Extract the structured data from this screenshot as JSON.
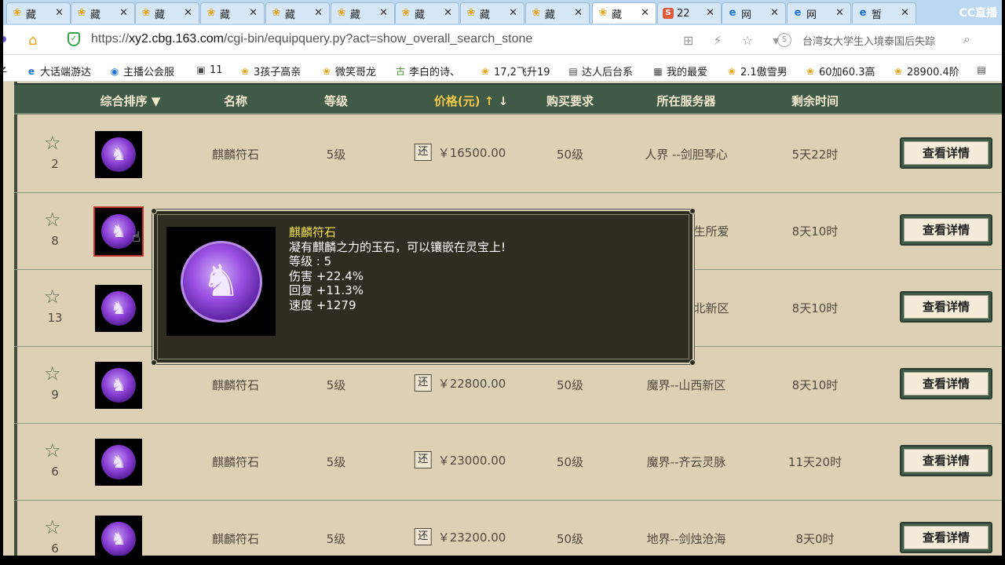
{
  "browser": {
    "tabs": [
      {
        "title": "藏",
        "icon": "cbg-icon",
        "active": false
      },
      {
        "title": "藏",
        "icon": "cbg-icon",
        "active": false
      },
      {
        "title": "藏",
        "icon": "cbg-icon",
        "active": false
      },
      {
        "title": "藏",
        "icon": "cbg-icon",
        "active": false
      },
      {
        "title": "藏",
        "icon": "cbg-icon",
        "active": false
      },
      {
        "title": "藏",
        "icon": "cbg-icon",
        "active": false
      },
      {
        "title": "藏",
        "icon": "cbg-icon",
        "active": false
      },
      {
        "title": "藏",
        "icon": "cbg-icon",
        "active": false
      },
      {
        "title": "藏",
        "icon": "cbg-icon",
        "active": false
      },
      {
        "title": "藏",
        "icon": "cbg-icon",
        "active": true
      },
      {
        "title": "22",
        "icon": "sogou-icon",
        "active": false
      },
      {
        "title": "网",
        "icon": "browser-e-icon",
        "active": false
      },
      {
        "title": "网",
        "icon": "browser-e-icon",
        "active": false
      },
      {
        "title": "暂",
        "icon": "browser-e-icon",
        "active": false
      }
    ],
    "close_glyph": "✕",
    "watermark": "CC直播",
    "url_prefix": "https://",
    "url_host": "xy2.cbg.163.com",
    "url_path": "/cgi-bin/equipquery.py?act=show_overall_search_stone",
    "search_text": "台湾女大学生入境泰国后失踪",
    "search_engine_glyph": "S",
    "toolbar_glyphs": "⊞ ⚡ ☆ ▾",
    "bookmarks": [
      {
        "label": "子",
        "icon": "none"
      },
      {
        "label": "大话端游达",
        "icon": "browser-e-icon"
      },
      {
        "label": "主播公会服",
        "icon": "globe-icon"
      },
      {
        "label": "11",
        "icon": "game-icon"
      },
      {
        "label": "3孩子高亲",
        "icon": "cbg-icon"
      },
      {
        "label": "微笑哥龙",
        "icon": "cbg-icon"
      },
      {
        "label": "李白的诗、",
        "icon": "leaf-icon"
      },
      {
        "label": "17,2飞升19",
        "icon": "cbg-icon"
      },
      {
        "label": "达人后台系",
        "icon": "doc-icon"
      },
      {
        "label": "我的最爱",
        "icon": "grid-icon"
      },
      {
        "label": "2.1傲雪男",
        "icon": "cbg-icon"
      },
      {
        "label": "60加60.3高",
        "icon": "cbg-icon"
      },
      {
        "label": "28900.4阶",
        "icon": "cbg-icon"
      },
      {
        "label": "",
        "icon": "doc-icon"
      }
    ]
  },
  "table": {
    "headers": {
      "sort": "综合排序 ▼",
      "name": "名称",
      "level": "等级",
      "price": "价格(元)",
      "price_up": "↑",
      "price_down": "↓",
      "requirement": "购买要求",
      "server": "所在服务器",
      "remaining": "剩余时间"
    },
    "huan_label": "还",
    "detail_label": "查看详情",
    "rows": [
      {
        "favs": "2",
        "name": "麒麟符石",
        "level": "5级",
        "price": "￥16500.00",
        "req": "50级",
        "server": "人界 --剑胆琴心",
        "time": "5天22时"
      },
      {
        "favs": "8",
        "name": "",
        "level": "",
        "price": "",
        "req": "",
        "server": "生所爱",
        "time": "8天10时"
      },
      {
        "favs": "13",
        "name": "",
        "level": "",
        "price": "",
        "req": "",
        "server": "北新区",
        "time": "8天10时"
      },
      {
        "favs": "9",
        "name": "麒麟符石",
        "level": "5级",
        "price": "￥22800.00",
        "req": "50级",
        "server": "魔界--山西新区",
        "time": "8天10时"
      },
      {
        "favs": "6",
        "name": "麒麟符石",
        "level": "5级",
        "price": "￥23000.00",
        "req": "50级",
        "server": "魔界--齐云灵脉",
        "time": "11天20时"
      },
      {
        "favs": "6",
        "name": "麒麟符石",
        "level": "5级",
        "price": "￥23200.00",
        "req": "50级",
        "server": "地界--剑烛沧海",
        "time": "8天0时"
      }
    ]
  },
  "tooltip": {
    "name": "麒麟符石",
    "description": "凝有麒麟之力的玉石，可以镶嵌在灵宝上!",
    "level": "等级 : 5",
    "damage": "伤害 +22.4%",
    "recovery": "回复 +11.3%",
    "speed": "速度 +1279"
  },
  "colors": {
    "header_bg": "#3f5a47",
    "page_bg": "#ddd0b4",
    "tooltip_bg": "#2f2d21",
    "tooltip_name": "#f0e24a",
    "price_header": "#f5c84a"
  }
}
